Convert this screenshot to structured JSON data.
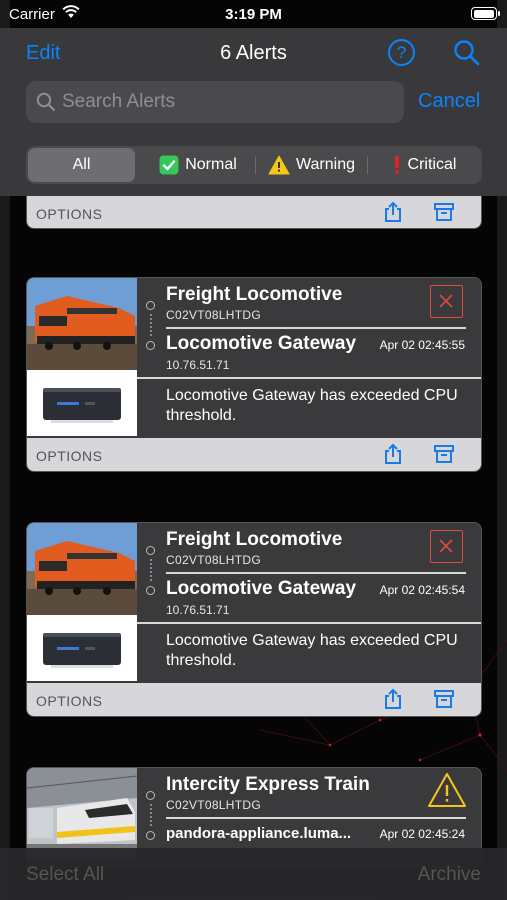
{
  "status_bar": {
    "carrier": "Carrier",
    "time": "3:19 PM",
    "battery_level": 1.0
  },
  "nav": {
    "edit_label": "Edit",
    "title": "6 Alerts",
    "help_icon": "question-circle-icon",
    "search_icon": "magnifier-icon"
  },
  "search": {
    "placeholder": "Search Alerts",
    "value": "",
    "cancel_label": "Cancel"
  },
  "filters": [
    {
      "label": "All",
      "icon": "",
      "selected": true
    },
    {
      "label": "Normal",
      "icon": "check-box-icon",
      "selected": false
    },
    {
      "label": "Warning",
      "icon": "warning-triangle-icon",
      "selected": false
    },
    {
      "label": "Critical",
      "icon": "exclamation-icon",
      "selected": false
    }
  ],
  "colors": {
    "accent": "#0a84ff",
    "critical": "#e04b3c",
    "warning": "#f5c518",
    "normal": "#34c759"
  },
  "options_label": "OPTIONS",
  "alerts": [
    {
      "asset_name": "Freight Locomotive",
      "asset_id": "C02VT08LHTDG",
      "device_name": "Locomotive Gateway",
      "timestamp": "Apr 02 02:45:55",
      "ip": "10.76.51.71",
      "message": "Locomotive Gateway has exceeded CPU threshold.",
      "severity": "critical"
    },
    {
      "asset_name": "Freight Locomotive",
      "asset_id": "C02VT08LHTDG",
      "device_name": "Locomotive Gateway",
      "timestamp": "Apr 02 02:45:54",
      "ip": "10.76.51.71",
      "message": "Locomotive Gateway has exceeded CPU threshold.",
      "severity": "critical"
    },
    {
      "asset_name": "Intercity Express Train",
      "asset_id": "C02VT08LHTDG",
      "device_name": "pandora-appliance.luma...",
      "timestamp": "Apr 02 02:45:24",
      "severity": "warning"
    }
  ],
  "toolbar": {
    "select_all_label": "Select All",
    "archive_label": "Archive"
  }
}
